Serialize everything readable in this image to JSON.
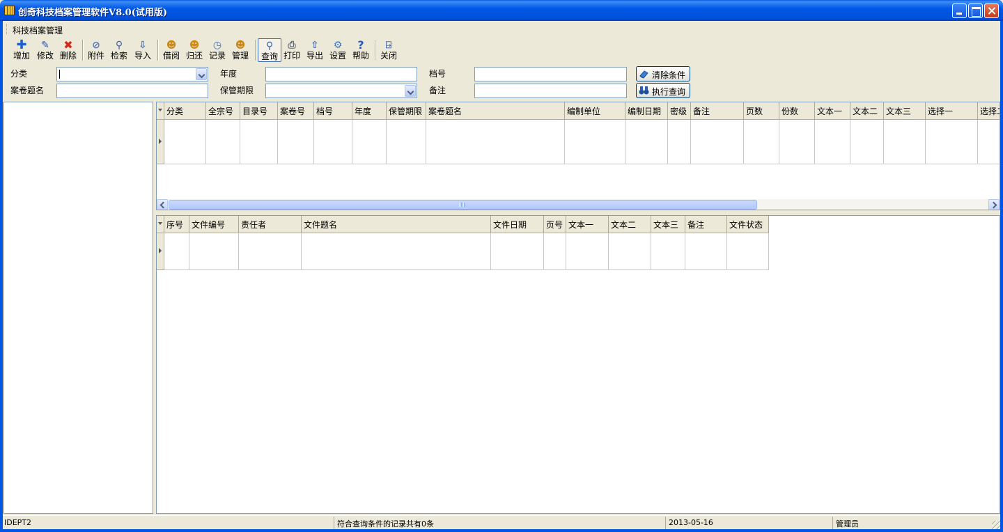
{
  "window": {
    "title": "创奇科技档案管理软件V8.0(试用版)"
  },
  "menu": {
    "items": [
      "科技档案管理"
    ]
  },
  "toolbar": {
    "buttons": [
      {
        "label": "增加",
        "icon": "add-icon"
      },
      {
        "label": "修改",
        "icon": "edit-pencil-icon"
      },
      {
        "label": "删除",
        "icon": "delete-x-icon"
      },
      {
        "label": "附件",
        "icon": "paperclip-icon"
      },
      {
        "label": "检索",
        "icon": "search-icon"
      },
      {
        "label": "导入",
        "icon": "import-icon"
      },
      {
        "label": "借阅",
        "icon": "borrow-user-icon"
      },
      {
        "label": "归还",
        "icon": "return-user-icon"
      },
      {
        "label": "记录",
        "icon": "clock-icon"
      },
      {
        "label": "管理",
        "icon": "admin-user-icon"
      },
      {
        "label": "查询",
        "icon": "query-magnifier-icon"
      },
      {
        "label": "打印",
        "icon": "printer-icon"
      },
      {
        "label": "导出",
        "icon": "export-icon"
      },
      {
        "label": "设置",
        "icon": "settings-gear-icon"
      },
      {
        "label": "帮助",
        "icon": "help-question-icon"
      },
      {
        "label": "关闭",
        "icon": "exit-door-icon"
      }
    ],
    "active": "查询"
  },
  "filter": {
    "category_label": "分类",
    "year_label": "年度",
    "archive_no_label": "档号",
    "title_label": "案卷题名",
    "retention_label": "保管期限",
    "remark_label": "备注",
    "category_value": "",
    "year_value": "",
    "archive_no_value": "",
    "title_value": "",
    "retention_value": "",
    "remark_value": "",
    "clear_button": "清除条件",
    "execute_button": "执行查询"
  },
  "grid_volumes": {
    "columns": [
      "分类",
      "全宗号",
      "目录号",
      "案卷号",
      "档号",
      "年度",
      "保管期限",
      "案卷题名",
      "编制单位",
      "编制日期",
      "密级",
      "备注",
      "页数",
      "份数",
      "文本一",
      "文本二",
      "文本三",
      "选择一",
      "选择二"
    ],
    "rows": []
  },
  "grid_files": {
    "columns": [
      "序号",
      "文件编号",
      "责任者",
      "文件题名",
      "文件日期",
      "页号",
      "文本一",
      "文本二",
      "文本三",
      "备注",
      "文件状态"
    ],
    "rows": []
  },
  "status": {
    "database": "IDEPT2",
    "message": "符合查询条件的记录共有0条",
    "date": "2013-05-16",
    "user": "管理员"
  },
  "colors": {
    "titlebar": "#0055E5",
    "chrome": "#ECE9D8",
    "border": "#7F9DB9"
  }
}
